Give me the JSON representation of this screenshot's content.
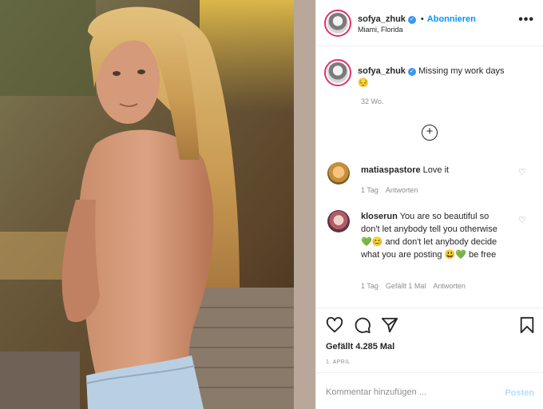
{
  "post": {
    "username": "sofya_zhuk",
    "follow_label": "Abonnieren",
    "separator": "•",
    "location": "Miami, Florida",
    "more_label": "•••",
    "caption": "Missing my work days",
    "caption_emoji": "😔",
    "caption_time": "32 Wo.",
    "load_more_label": "+",
    "likes": "Gefällt 4.285 Mal",
    "date": "1. APRIL"
  },
  "comments": [
    {
      "username": "matiaspastore",
      "text": "Love it",
      "time": "1 Tag",
      "likes": "",
      "reply": "Antworten"
    },
    {
      "username": "kloserun",
      "text": "You are so beautiful so don't let anybody tell you otherwise💚😊 and don't let anybody decide what you are posting 😃💚 be free",
      "time": "1 Tag",
      "likes": "Gefällt 1 Mal",
      "reply": "Antworten"
    }
  ],
  "comment_box": {
    "placeholder": "Kommentar hinzufügen ...",
    "post_label": "Posten"
  },
  "icons": {
    "verified": "verified-badge-icon",
    "heart": "heart-icon",
    "comment": "comment-icon",
    "share": "paper-plane-icon",
    "save": "bookmark-icon",
    "add": "plus-circle-icon",
    "more": "more-options-icon"
  },
  "colors": {
    "follow_blue": "#0095f6",
    "verified_blue": "#3897f0",
    "story_ring": "#e0316c",
    "muted_text": "#8e8e8e",
    "post_disabled": "#b2dffc"
  }
}
